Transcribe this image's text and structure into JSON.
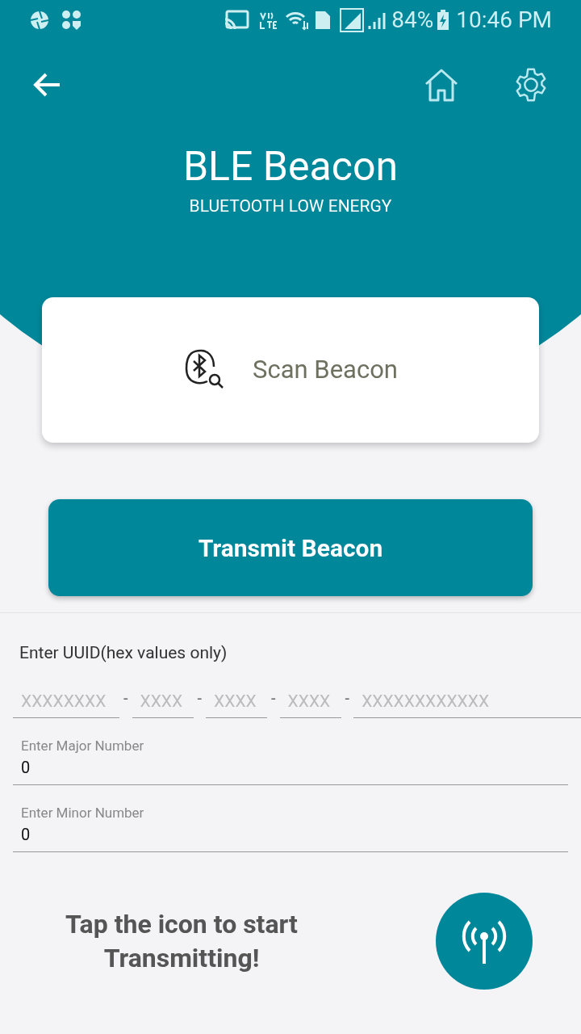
{
  "status_bar": {
    "battery": "84%",
    "time": "10:46 PM"
  },
  "header": {
    "title": "BLE Beacon",
    "subtitle": "BLUETOOTH LOW ENERGY"
  },
  "scan_button": {
    "label": "Scan Beacon"
  },
  "transmit_button": {
    "label": "Transmit Beacon"
  },
  "uuid": {
    "label": "Enter UUID(hex values only)",
    "segments": [
      {
        "placeholder": "XXXXXXXX"
      },
      {
        "placeholder": "XXXX"
      },
      {
        "placeholder": "XXXX"
      },
      {
        "placeholder": "XXXX"
      },
      {
        "placeholder": "XXXXXXXXXXXX"
      }
    ],
    "separator": "-"
  },
  "fields": [
    {
      "label": "Enter Major Number",
      "value": "0"
    },
    {
      "label": "Enter Minor Number",
      "value": "0"
    }
  ],
  "footer": {
    "hint": "Tap the icon to start Transmitting!"
  }
}
